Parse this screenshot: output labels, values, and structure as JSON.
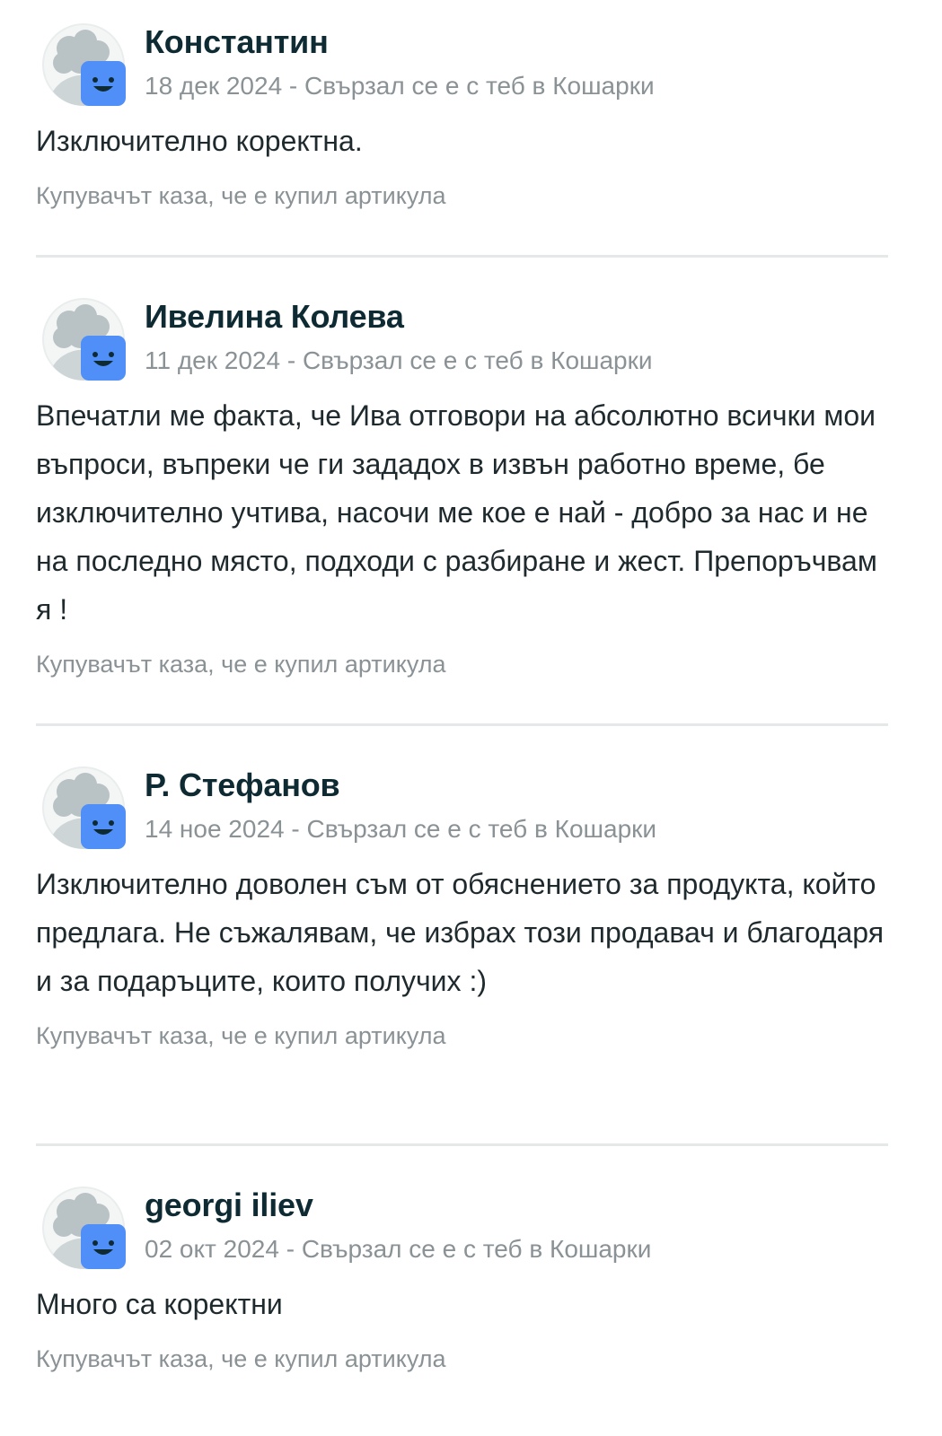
{
  "reviews": [
    {
      "username": "Константин",
      "meta": "18 дек 2024 - Свързал се е с теб в Кошарки",
      "text": "Изключително коректна.",
      "verified": "Купувачът каза, че е купил артикула"
    },
    {
      "username": "Ивелина Колева",
      "meta": "11 дек 2024 - Свързал се е с теб в Кошарки",
      "text": "Впечатли ме факта, че Ива отговори на абсолютно всички мои въпроси, въпреки че ги зададох в извън работно време, бе изключително учтива, насочи ме кое е най - добро за нас и не на последно място, подходи с разбиране и жест. Препоръчвам я !",
      "verified": "Купувачът каза, че е купил артикула"
    },
    {
      "username": "Р. Стефанов",
      "meta": "14 ное 2024 - Свързал се е с теб в Кошарки",
      "text": "Изключително доволен съм от обяснението за продукта, който предлага. Не съжалявам, че избрах този продавач и благодаря и за подаръците, които получих :)",
      "verified": "Купувачът каза, че е купил артикула"
    },
    {
      "username": "georgi iliev",
      "meta": "02 окт 2024 - Свързал се е с теб в Кошарки",
      "text": "Много са коректни",
      "verified": "Купувачът каза, че е купил артикула"
    }
  ],
  "icons": {
    "avatar": "default-avatar-icon",
    "badge": "smiley-badge-icon"
  },
  "colors": {
    "username": "#0e2a33",
    "meta": "#8a9296",
    "badge": "#4f8ff7",
    "divider": "#e4e8e8"
  }
}
